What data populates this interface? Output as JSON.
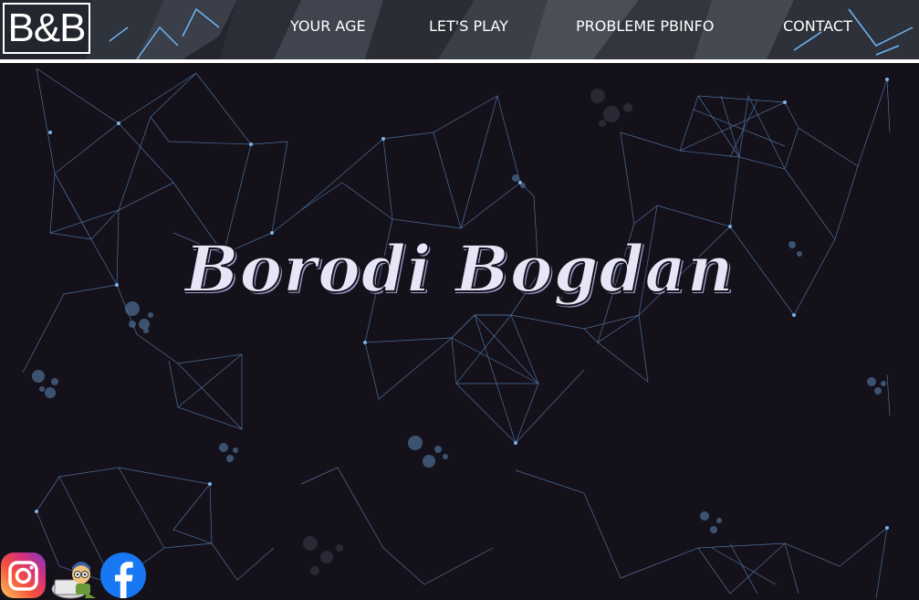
{
  "header": {
    "logo_text": "B&B",
    "nav": [
      {
        "label": "YOUR AGE"
      },
      {
        "label": "LET'S PLAY"
      },
      {
        "label": "PROBLEME PBINFO"
      },
      {
        "label": "CONTACT"
      }
    ]
  },
  "hero": {
    "title": "Borodi Bogdan"
  },
  "social": [
    {
      "icon": "instagram-icon"
    },
    {
      "icon": "pbinfo-icon"
    },
    {
      "icon": "facebook-icon"
    }
  ],
  "colors": {
    "background": "#15111b",
    "network_line": "#5f8fc4",
    "title": "#e6e6f7",
    "facebook": "#1877f2"
  }
}
